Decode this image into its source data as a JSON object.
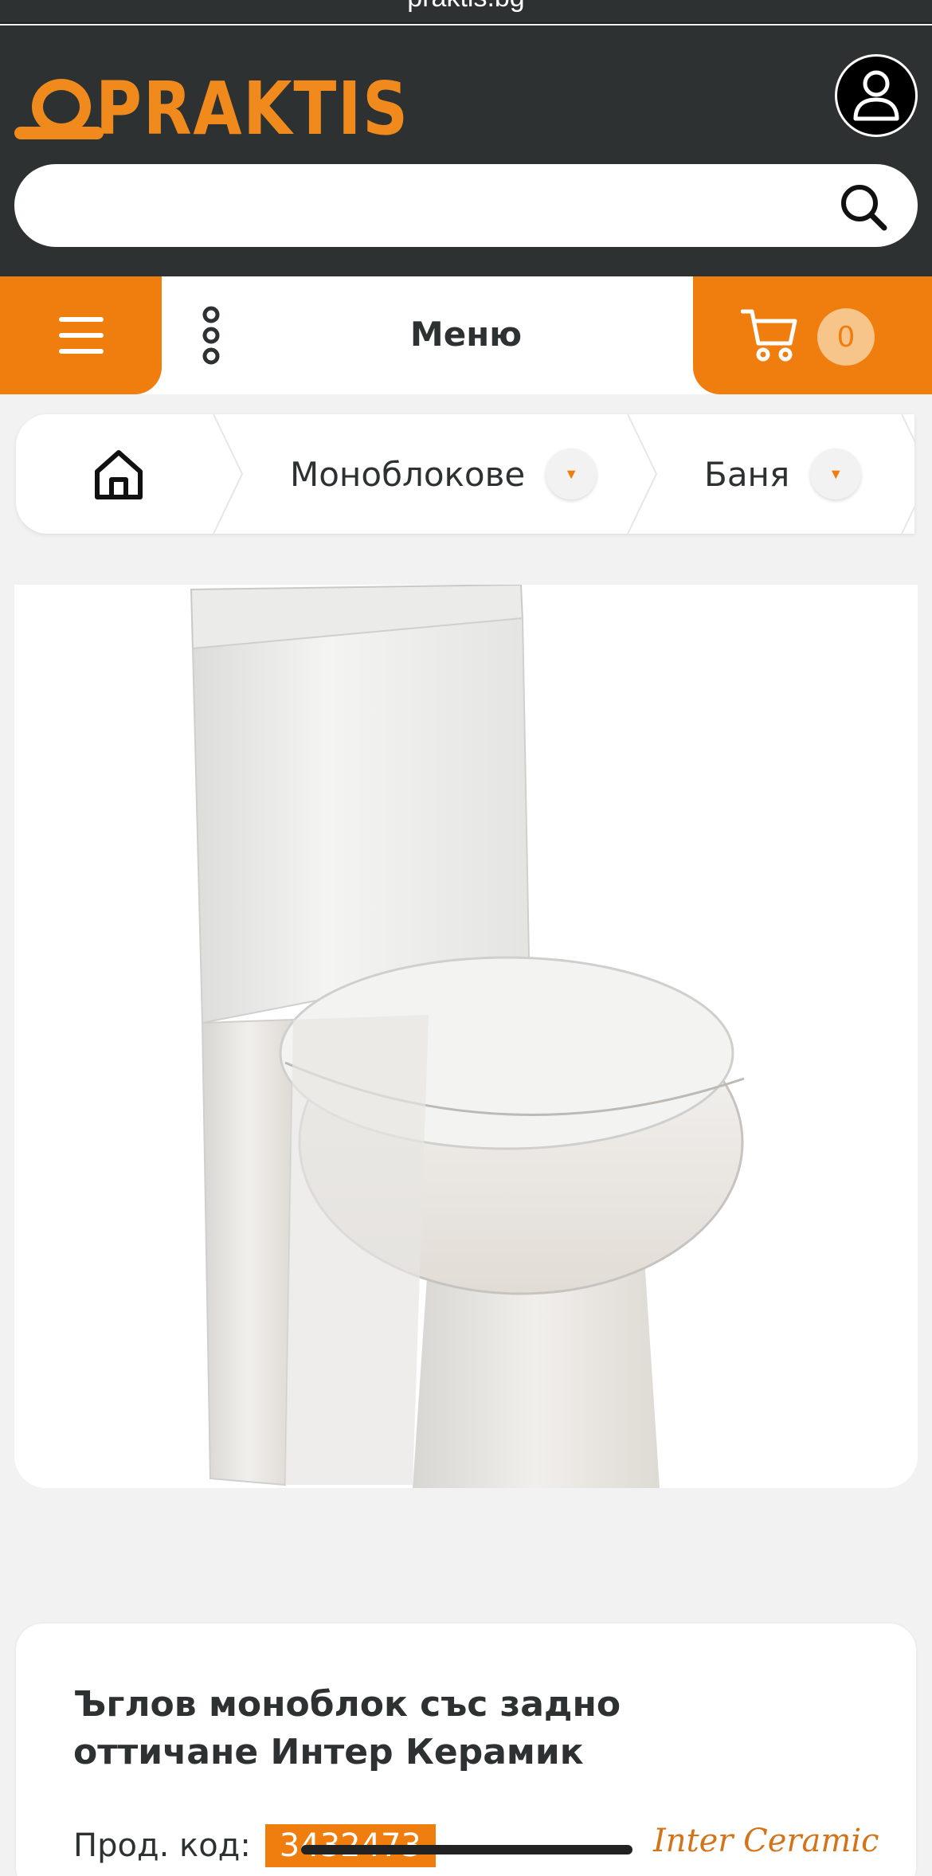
{
  "browser": {
    "url": "praktis.bg"
  },
  "header": {
    "logo_text": "PRAKTIS",
    "search": {
      "placeholder": "",
      "value": ""
    }
  },
  "nav": {
    "menu_label": "Меню",
    "cart_count": "0"
  },
  "breadcrumb": {
    "items": [
      {
        "label": "Моноблокове"
      },
      {
        "label": "Баня"
      }
    ]
  },
  "product": {
    "title": "Ъглов моноблок със задно оттичане Интер Керамик",
    "sku_label": "Прод. код:",
    "sku_value": "3432473",
    "brand": "Inter Ceramic"
  },
  "colors": {
    "brand_orange": "#ef7e0e",
    "header_dark": "#2d3131",
    "background": "#f2f2f2"
  }
}
